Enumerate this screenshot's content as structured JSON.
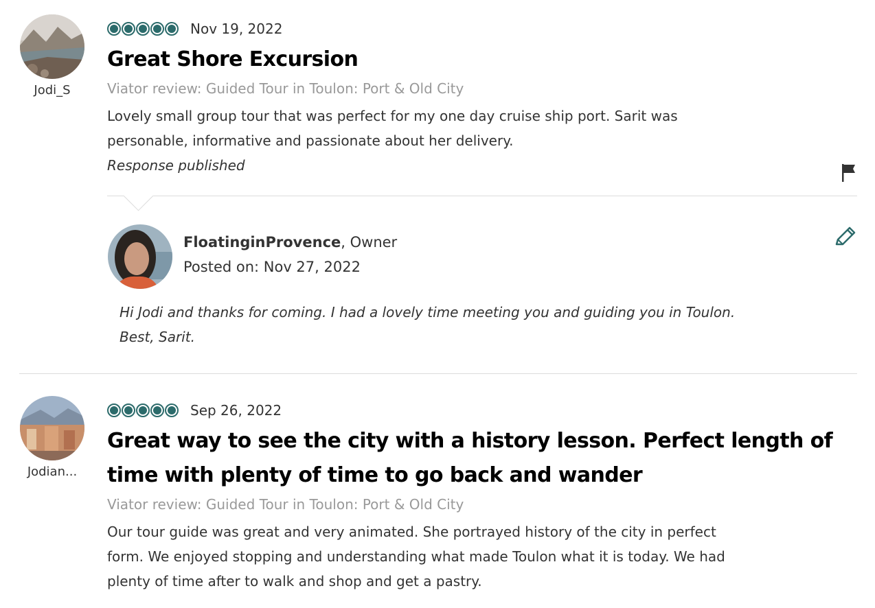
{
  "reviews": [
    {
      "username": "Jodi_S",
      "date": "Nov 19, 2022",
      "rating": 5,
      "title": "Great Shore Excursion",
      "source": "Viator review: Guided Tour in Toulon: Port & Old City",
      "body_lines": [
        "Lovely small group tour that was perfect for my one day cruise ship port. Sarit was",
        "personable, informative and passionate about her delivery."
      ],
      "response_status": "Response published",
      "response": {
        "owner_name": "FloatinginProvence",
        "owner_role": ", Owner",
        "posted_label": "Posted on: Nov 27, 2022",
        "text_lines": [
          "Hi Jodi and thanks for coming. I had a lovely time meeting you and guiding you in Toulon.",
          "Best, Sarit."
        ]
      }
    },
    {
      "username": "Jodian...",
      "date": "Sep 26, 2022",
      "rating": 5,
      "title_lines": [
        "Great way to see the city with a history lesson. Perfect length of",
        "time with plenty of time to go back and wander"
      ],
      "source": "Viator review: Guided Tour in Toulon: Port & Old City",
      "body_lines": [
        "Our tour guide was great and very animated. She portrayed history of the city in perfect",
        "form. We enjoyed stopping and understanding what made Toulon what it is today. We had",
        "plenty of time after to walk and shop and get a pastry."
      ]
    }
  ],
  "colors": {
    "bubble": "#2c6b6b",
    "source": "#999999",
    "edit_icon": "#2c6b6b"
  },
  "icons": {
    "flag": "flag-icon",
    "edit": "pencil-icon"
  }
}
